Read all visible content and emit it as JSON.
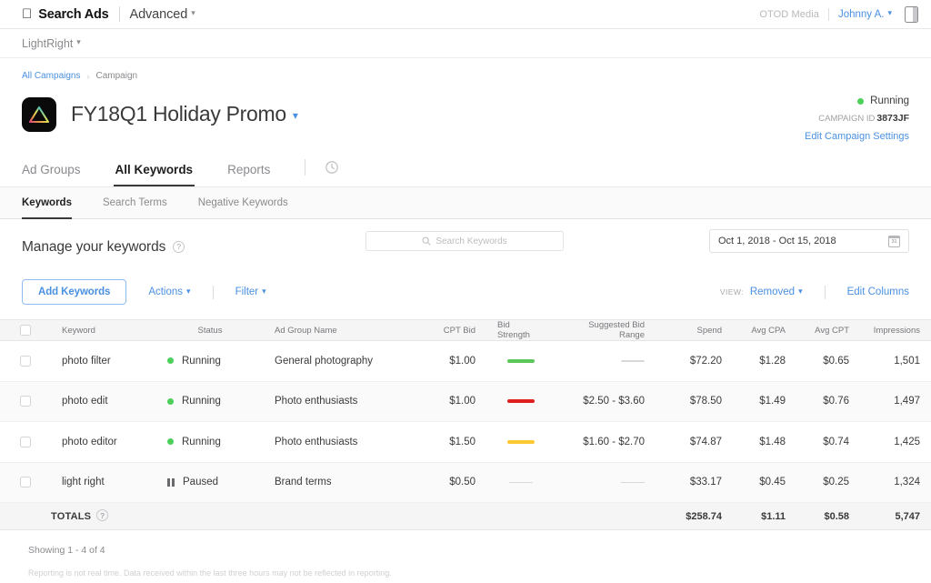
{
  "topbar": {
    "apple_glyph": "",
    "brand": "Search Ads",
    "edition": "Advanced",
    "org": "OTOD Media",
    "user": "Johnny A.",
    "panel_icon": "sidebar-toggle-icon"
  },
  "account": {
    "name": "LightRight"
  },
  "breadcrumb": {
    "root": "All Campaigns",
    "separator": "›",
    "current": "Campaign"
  },
  "campaign": {
    "title": "FY18Q1 Holiday Promo",
    "status": "Running",
    "id_label": "CAMPAIGN ID",
    "id_value": "3873JF",
    "edit_link": "Edit Campaign Settings",
    "status_color": "#4cd05a"
  },
  "main_tabs": [
    {
      "label": "Ad Groups",
      "active": false
    },
    {
      "label": "All Keywords",
      "active": true
    },
    {
      "label": "Reports",
      "active": false
    }
  ],
  "history_icon": "history-clock-icon",
  "sub_tabs": [
    {
      "label": "Keywords",
      "active": true
    },
    {
      "label": "Search Terms",
      "active": false
    },
    {
      "label": "Negative Keywords",
      "active": false
    }
  ],
  "manage": {
    "title": "Manage your keywords",
    "help_glyph": "?",
    "search_placeholder": "Search Keywords",
    "search_value": "",
    "date_range": "Oct 1, 2018 - Oct 15, 2018",
    "calendar_day": "31"
  },
  "toolbar": {
    "add_label": "Add Keywords",
    "actions_label": "Actions",
    "filter_label": "Filter",
    "view_label": "VIEW:",
    "view_value": "Removed",
    "edit_columns": "Edit Columns"
  },
  "table": {
    "columns": [
      "Keyword",
      "Status",
      "Ad Group Name",
      "CPT Bid",
      "Bid Strength",
      "Suggested Bid Range",
      "Spend",
      "Avg CPA",
      "Avg CPT",
      "Impressions"
    ],
    "rows": [
      {
        "keyword": "photo filter",
        "status": "Running",
        "status_type": "running",
        "ad_group": "General photography",
        "cpt_bid": "$1.00",
        "bid_strength": "green",
        "bid_strength_color": "#5bc85b",
        "suggested": "—",
        "spend": "$72.20",
        "avg_cpa": "$1.28",
        "avg_cpt": "$0.65",
        "impressions": "1,501"
      },
      {
        "keyword": "photo edit",
        "status": "Running",
        "status_type": "running",
        "ad_group": "Photo enthusiasts",
        "cpt_bid": "$1.00",
        "bid_strength": "red",
        "bid_strength_color": "#e02020",
        "suggested": "$2.50 - $3.60",
        "spend": "$78.50",
        "avg_cpa": "$1.49",
        "avg_cpt": "$0.76",
        "impressions": "1,497"
      },
      {
        "keyword": "photo editor",
        "status": "Running",
        "status_type": "running",
        "ad_group": "Photo enthusiasts",
        "cpt_bid": "$1.50",
        "bid_strength": "yellow",
        "bid_strength_color": "#fcc933",
        "suggested": "$1.60 - $2.70",
        "spend": "$74.87",
        "avg_cpa": "$1.48",
        "avg_cpt": "$0.74",
        "impressions": "1,425"
      },
      {
        "keyword": "light right",
        "status": "Paused",
        "status_type": "paused",
        "ad_group": "Brand terms",
        "cpt_bid": "$0.50",
        "bid_strength": "none",
        "bid_strength_color": "#d8d8d8",
        "suggested": "—",
        "spend": "$33.17",
        "avg_cpa": "$0.45",
        "avg_cpt": "$0.25",
        "impressions": "1,324"
      }
    ],
    "totals": {
      "label": "TOTALS",
      "help_glyph": "?",
      "spend": "$258.74",
      "avg_cpa": "$1.11",
      "avg_cpt": "$0.58",
      "impressions": "5,747"
    }
  },
  "footer": {
    "showing": "Showing 1 - 4 of 4",
    "disclaimer": "Reporting is not real time. Data received within the last three hours may not be reflected in reporting."
  }
}
